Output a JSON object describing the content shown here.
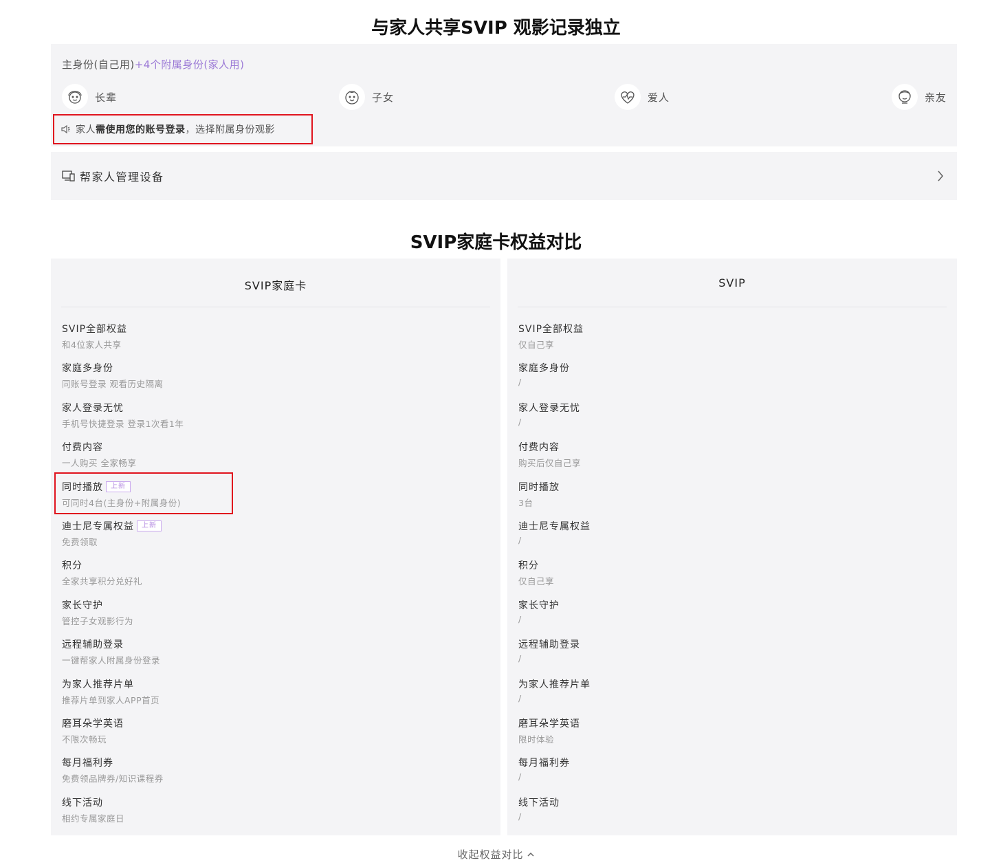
{
  "section1": {
    "title": "与家人共享SVIP 观影记录独立",
    "header_main": "主身份(自己用)",
    "header_accent": "+4个附属身份(家人用)",
    "members": [
      {
        "label": "长辈",
        "icon": "elder-avatar-icon"
      },
      {
        "label": "子女",
        "icon": "child-avatar-icon"
      },
      {
        "label": "爱人",
        "icon": "heart-avatar-icon"
      },
      {
        "label": "亲友",
        "icon": "friend-avatar-icon"
      }
    ],
    "notice": {
      "icon": "speaker-icon",
      "prefix": "家人",
      "bold": "需使用您的账号登录",
      "suffix": "，选择附属身份观影"
    }
  },
  "devices": {
    "icon": "devices-icon",
    "label": "帮家人管理设备",
    "chevron": "chevron-right-icon"
  },
  "section2": {
    "title": "SVIP家庭卡权益对比",
    "columns": [
      {
        "header": "SVIP家庭卡",
        "rows": [
          {
            "title": "SVIP全部权益",
            "sub": "和4位家人共享"
          },
          {
            "title": "家庭多身份",
            "sub": "同账号登录 观看历史隔离"
          },
          {
            "title": "家人登录无忧",
            "sub": "手机号快捷登录 登录1次看1年"
          },
          {
            "title": "付费内容",
            "sub": "一人购买 全家畅享"
          },
          {
            "title": "同时播放",
            "sub": "可同时4台(主身份+附属身份)",
            "tag": "上新"
          },
          {
            "title": "迪士尼专属权益",
            "sub": "免费领取",
            "tag": "上新"
          },
          {
            "title": "积分",
            "sub": "全家共享积分兑好礼"
          },
          {
            "title": "家长守护",
            "sub": "管控子女观影行为"
          },
          {
            "title": "远程辅助登录",
            "sub": "一键帮家人附属身份登录"
          },
          {
            "title": "为家人推荐片单",
            "sub": "推荐片单到家人APP首页"
          },
          {
            "title": "磨耳朵学英语",
            "sub": "不限次畅玩"
          },
          {
            "title": "每月福利券",
            "sub": "免费领品牌券/知识课程券"
          },
          {
            "title": "线下活动",
            "sub": "相约专属家庭日"
          }
        ]
      },
      {
        "header": "SVIP",
        "rows": [
          {
            "title": "SVIP全部权益",
            "sub": "仅自己享"
          },
          {
            "title": "家庭多身份",
            "sub": "/"
          },
          {
            "title": "家人登录无忧",
            "sub": "/"
          },
          {
            "title": "付费内容",
            "sub": "购买后仅自己享"
          },
          {
            "title": "同时播放",
            "sub": "3台"
          },
          {
            "title": "迪士尼专属权益",
            "sub": "/"
          },
          {
            "title": "积分",
            "sub": "仅自己享"
          },
          {
            "title": "家长守护",
            "sub": "/"
          },
          {
            "title": "远程辅助登录",
            "sub": "/"
          },
          {
            "title": "为家人推荐片单",
            "sub": "/"
          },
          {
            "title": "磨耳朵学英语",
            "sub": "限时体验"
          },
          {
            "title": "每月福利券",
            "sub": "/"
          },
          {
            "title": "线下活动",
            "sub": "/"
          }
        ]
      }
    ]
  },
  "collapse": {
    "label": "收起权益对比",
    "icon": "chevron-up-icon"
  },
  "colors": {
    "accent": "#9b79d6",
    "highlight_border": "#e0141e",
    "panel_bg": "#f4f4f6"
  }
}
